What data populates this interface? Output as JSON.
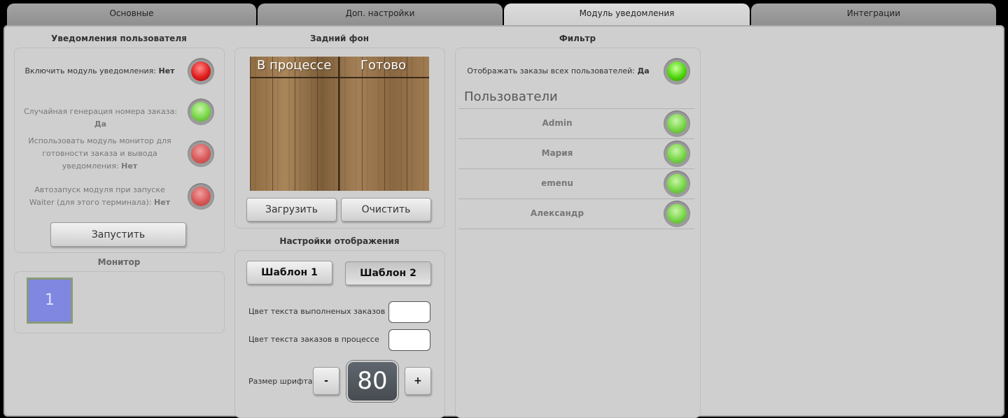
{
  "tabs": [
    {
      "label": "Основные"
    },
    {
      "label": "Доп. настройки"
    },
    {
      "label": "Модуль уведомления"
    },
    {
      "label": "Интеграции"
    }
  ],
  "notifications": {
    "title": "Уведомления пользователя",
    "rows": [
      {
        "text": "Включить модуль уведомления: ",
        "value": "Нет",
        "state": "red"
      },
      {
        "text": "Случайная генерация номера заказа: ",
        "value": "Да",
        "state": "green-dim"
      },
      {
        "text": "Использовать модуль монитор для готовности заказа и вывода уведомления: ",
        "value": "Нет",
        "state": "red-dim"
      },
      {
        "text": "Автозапуск модуля при запуске Waiter (для этого терминала): ",
        "value": "Нет",
        "state": "red-dim"
      }
    ],
    "start_button": "Запустить"
  },
  "monitor": {
    "title": "Монитор",
    "tile_label": "1"
  },
  "background": {
    "title": "Задний фон",
    "col_in_progress": "В процессе",
    "col_ready": "Готово",
    "upload_button": "Загрузить",
    "clear_button": "Очистить"
  },
  "display": {
    "title": "Настройки отображения",
    "template1": "Шаблон 1",
    "template2": "Шаблон 2",
    "done_color_label": "Цвет текста выполненых заказов",
    "progress_color_label": "Цвет текста заказов в процессе",
    "font_size_label": "Размер шрифта",
    "font_minus": "-",
    "font_plus": "+",
    "font_size": "80"
  },
  "filter": {
    "title": "Фильтр",
    "all_users_text": "Отображать заказы всех пользователей: ",
    "all_users_value": "Да",
    "users_header": "Пользователи",
    "users": [
      {
        "name": "Admin"
      },
      {
        "name": "Мария"
      },
      {
        "name": "emenu"
      },
      {
        "name": "Александр"
      }
    ]
  }
}
